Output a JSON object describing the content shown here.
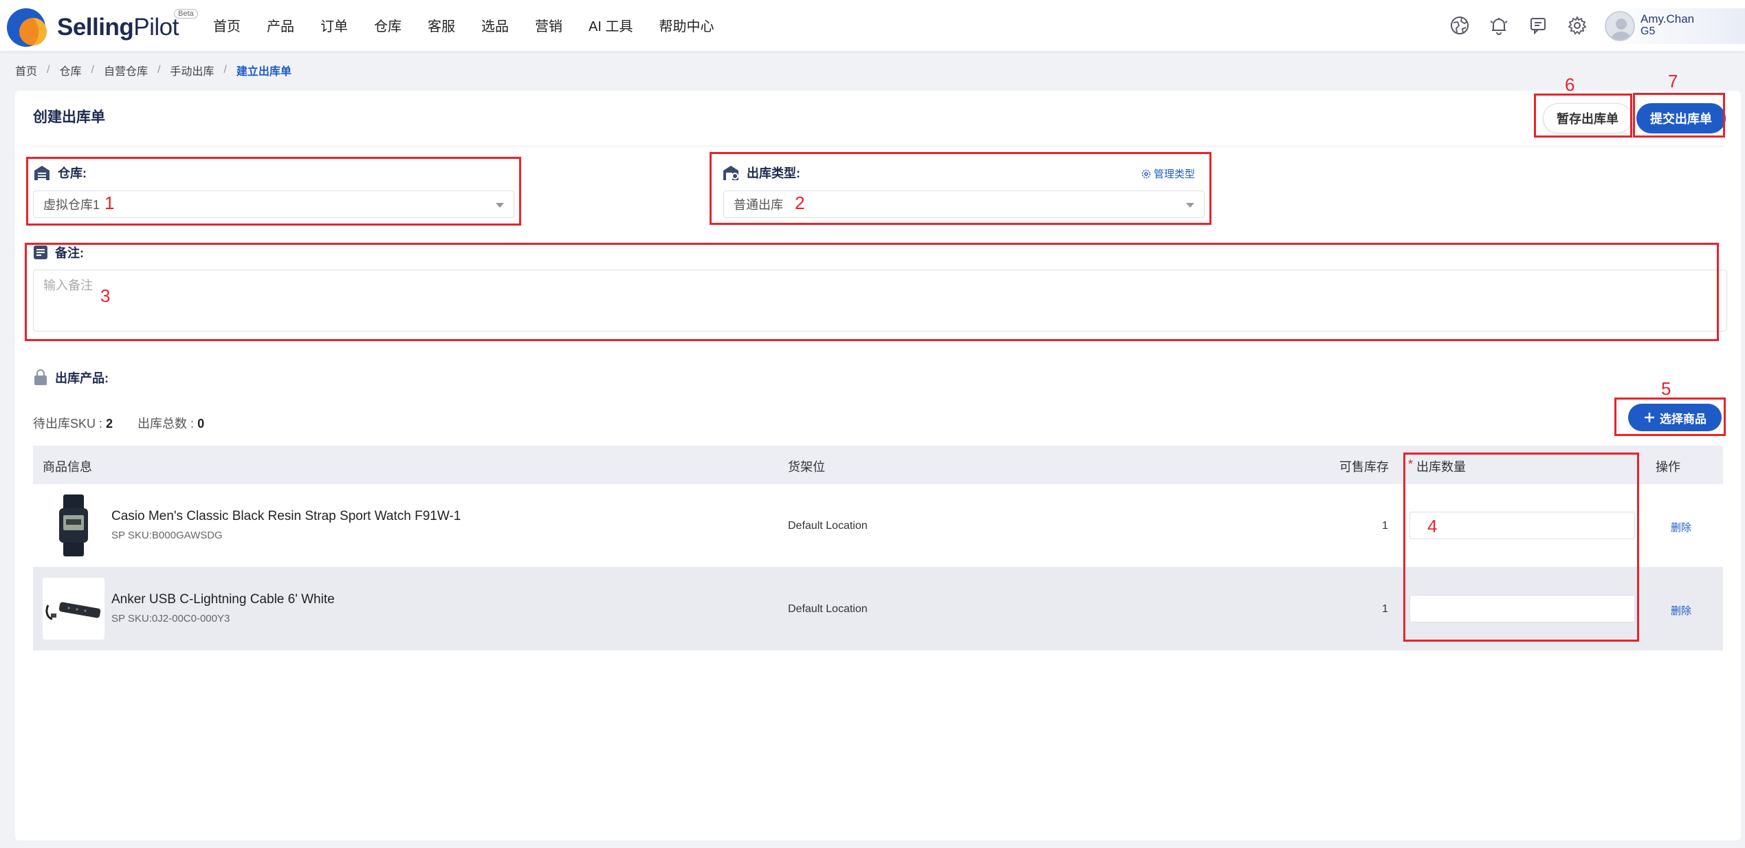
{
  "nav": {
    "logo_bold": "Selling",
    "logo_light": "Pilot",
    "beta": "Beta",
    "menu": [
      "首页",
      "产品",
      "订单",
      "仓库",
      "客服",
      "选品",
      "营销",
      "AI 工具",
      "帮助中心"
    ],
    "user_name": "Amy.Chan",
    "user_sub": "G5"
  },
  "breadcrumb": [
    "首页",
    "仓库",
    "自营仓库",
    "手动出库",
    "建立出库单"
  ],
  "page": {
    "title": "创建出库单",
    "save_draft": "暂存出库单",
    "submit": "提交出库单"
  },
  "form": {
    "warehouse_label": "仓库:",
    "warehouse_value": "虚拟仓库1",
    "type_label": "出库类型:",
    "type_value": "普通出库",
    "manage_types": "管理类型",
    "remark_label": "备注:",
    "remark_placeholder": "输入备注"
  },
  "products": {
    "section_label": "出库产品:",
    "pending_sku_label": "待出库SKU :",
    "pending_sku_value": "2",
    "total_label": "出库总数 :",
    "total_value": "0",
    "select_button": "选择商品",
    "headers": {
      "info": "商品信息",
      "location": "货架位",
      "stock": "可售库存",
      "required": "*",
      "qty": "出库数量",
      "action": "操作"
    },
    "rows": [
      {
        "name": "Casio Men's Classic Black Resin Strap Sport Watch F91W-1",
        "sku": "SP SKU:B000GAWSDG",
        "location": "Default Location",
        "stock": "1",
        "delete": "删除"
      },
      {
        "name": "Anker USB C-Lightning Cable 6' White",
        "sku": "SP SKU:0J2-00C0-000Y3",
        "location": "Default Location",
        "stock": "1",
        "delete": "删除"
      }
    ]
  },
  "annotations": [
    "1",
    "2",
    "3",
    "4",
    "5",
    "6",
    "7"
  ],
  "colors": {
    "primary": "#1e5bc6",
    "annotation": "#e8232a",
    "title": "#1d2a50"
  }
}
